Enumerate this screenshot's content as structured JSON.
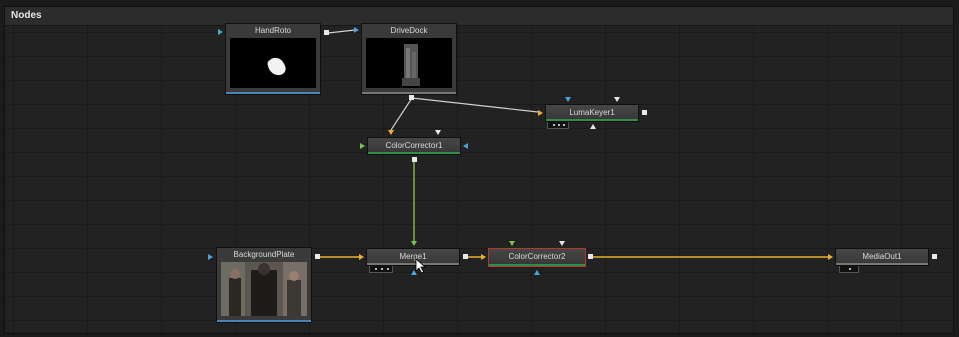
{
  "panel": {
    "title": "Nodes"
  },
  "nodes": {
    "handroto": {
      "label": "HandRoto"
    },
    "drivedock": {
      "label": "DriveDock"
    },
    "lumakeyer": {
      "label": "LumaKeyer1"
    },
    "colorcorrector1": {
      "label": "ColorCorrector1"
    },
    "backgroundplate": {
      "label": "BackgroundPlate"
    },
    "merge": {
      "label": "Merge1"
    },
    "colorcorrector2": {
      "label": "ColorCorrector2"
    },
    "mediaout": {
      "label": "MediaOut1"
    }
  },
  "colors": {
    "wire_white": "#d0d0d0",
    "wire_yellow": "#e8b230",
    "wire_green": "#7ec24a",
    "input_blue": "#4ca3dc",
    "selection_red": "#b03a2e"
  },
  "icons": {
    "cursor": "mouse-pointer-icon"
  }
}
